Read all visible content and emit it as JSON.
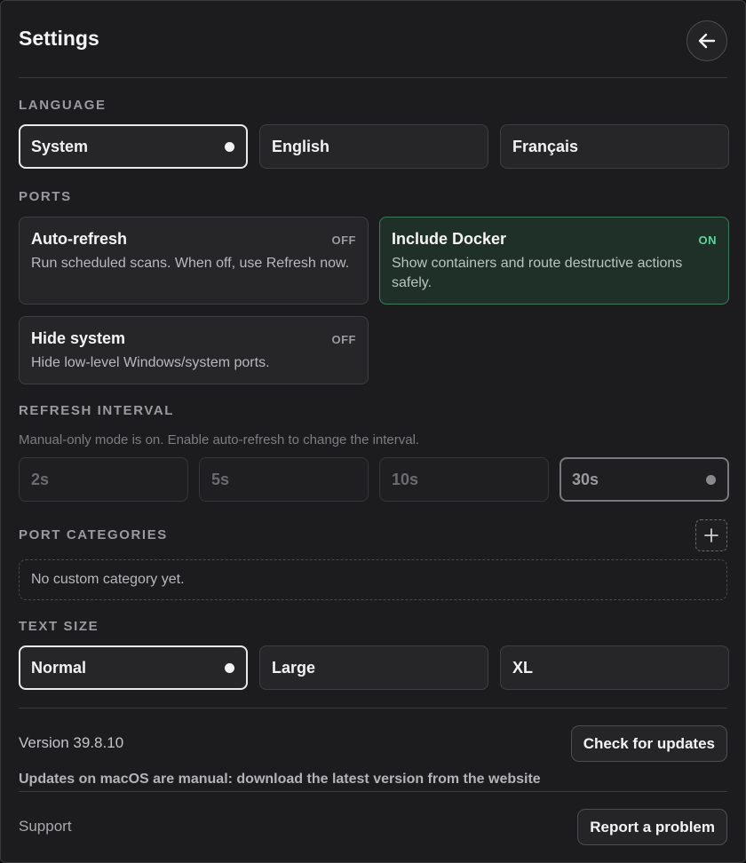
{
  "header": {
    "title": "Settings",
    "back_icon": "arrow-left-icon"
  },
  "language": {
    "label": "LANGUAGE",
    "options": [
      "System",
      "English",
      "Français"
    ],
    "selected": "System"
  },
  "ports": {
    "label": "PORTS",
    "toggles": [
      {
        "title": "Auto-refresh",
        "state": "OFF",
        "description": "Run scheduled scans. When off, use Refresh now."
      },
      {
        "title": "Include Docker",
        "state": "ON",
        "description": "Show containers and route destructive actions safely."
      },
      {
        "title": "Hide system",
        "state": "OFF",
        "description": "Hide low-level Windows/system ports."
      }
    ]
  },
  "refresh_interval": {
    "label": "REFRESH INTERVAL",
    "hint": "Manual-only mode is on. Enable auto-refresh to change the interval.",
    "options": [
      "2s",
      "5s",
      "10s",
      "30s"
    ],
    "selected": "30s"
  },
  "port_categories": {
    "label": "PORT CATEGORIES",
    "add_icon": "plus-icon",
    "empty_text": "No custom category yet."
  },
  "text_size": {
    "label": "TEXT SIZE",
    "options": [
      "Normal",
      "Large",
      "XL"
    ],
    "selected": "Normal"
  },
  "footer": {
    "version": "Version 39.8.10",
    "check_updates_label": "Check for updates",
    "update_note": "Updates on macOS are manual: download the latest version from the website",
    "support_label": "Support",
    "report_label": "Report a problem"
  },
  "colors": {
    "on_accent": "#5ed39a",
    "on_card_bg": "#1f3029",
    "on_card_border": "#3f7a5d"
  }
}
